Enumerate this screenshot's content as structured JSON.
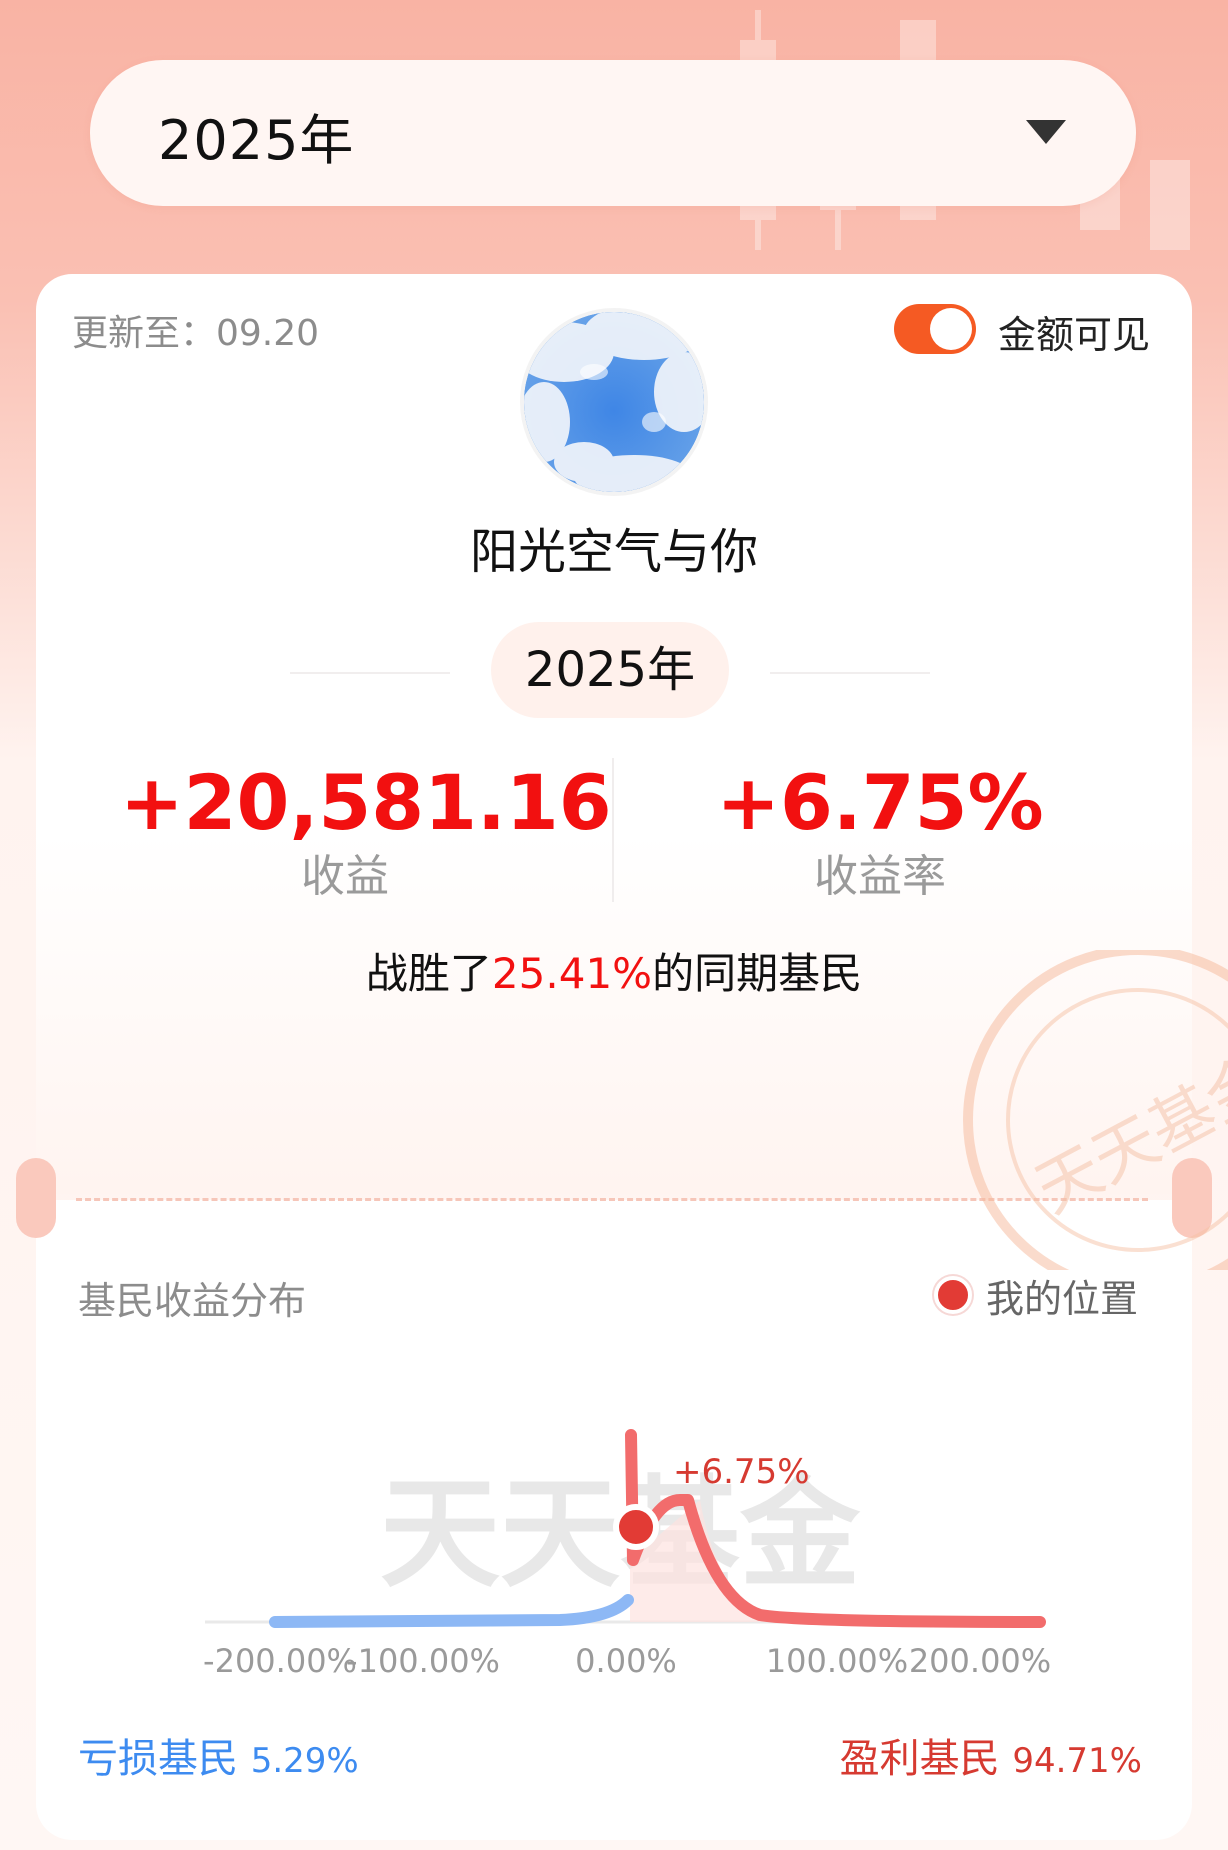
{
  "year_select": {
    "value": "2025年"
  },
  "card": {
    "update_text": "更新至：09.20",
    "toggle_label": "金额可见",
    "toggle_on": true,
    "username": "阳光空气与你",
    "year_pill": "2025年",
    "profit_value": "+20,581.16",
    "profit_label": "收益",
    "rate_value": "+6.75%",
    "rate_label": "收益率",
    "beat_prefix": "战胜了",
    "beat_percent": "25.41%",
    "beat_suffix": "的同期基民"
  },
  "distribution": {
    "title": "基民收益分布",
    "legend": "我的位置",
    "watermark": "天天基金",
    "marker_label": "+6.75%",
    "x_ticks": [
      "-200.00%",
      "-100.00%",
      "0.00%",
      "100.00%",
      "200.00%"
    ],
    "loss_label": "亏损基民",
    "loss_percent": "5.29%",
    "profit_label": "盈利基民",
    "profit_percent": "94.71%"
  },
  "colors": {
    "accent": "#f55a23",
    "profit": "#f21010",
    "loss": "#3d8bf0",
    "curve_red": "#f26c6c",
    "curve_blue": "#8db8f5"
  }
}
